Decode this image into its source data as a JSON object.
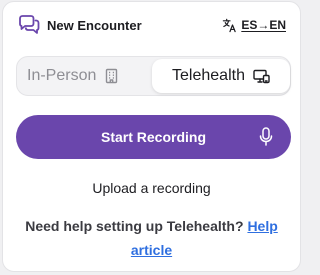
{
  "header": {
    "title": "New Encounter",
    "language_toggle": "ES→EN",
    "icons": {
      "logo": "chat-bubbles-icon",
      "language": "translate-icon"
    }
  },
  "mode_toggle": {
    "options": [
      {
        "label": "In-Person",
        "icon": "building-icon",
        "selected": false
      },
      {
        "label": "Telehealth",
        "icon": "video-screen-icon",
        "selected": true
      }
    ]
  },
  "record_button": {
    "label": "Start Recording",
    "icon": "microphone-icon"
  },
  "upload_link": {
    "label": "Upload a recording"
  },
  "help": {
    "text": "Need help setting up Telehealth?",
    "link_text_1": "Help",
    "link_text_2": "article"
  },
  "colors": {
    "accent": "#6a46ac",
    "link": "#2f6fe0",
    "text": "#1d1d21",
    "muted": "#8e8e94"
  }
}
